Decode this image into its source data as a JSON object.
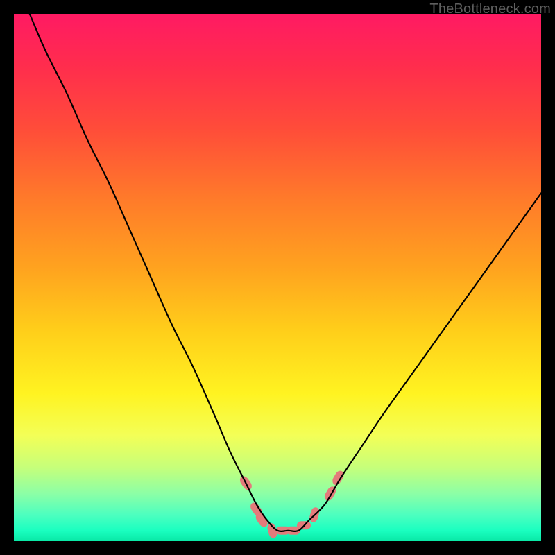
{
  "watermark": "TheBottleneck.com",
  "chart_data": {
    "type": "line",
    "title": "",
    "xlabel": "",
    "ylabel": "",
    "xlim": [
      0,
      100
    ],
    "ylim": [
      0,
      100
    ],
    "grid": false,
    "legend": false,
    "background_gradient": [
      "#ff1a63",
      "#ff2d4d",
      "#ff4d39",
      "#ff7a2a",
      "#ffa21f",
      "#ffce1a",
      "#fff321",
      "#f3ff57",
      "#c6ff7a",
      "#8cffa6",
      "#4dffbf",
      "#1affc0",
      "#09e8a6"
    ],
    "series": [
      {
        "name": "bottleneck-curve",
        "color": "#000000",
        "x": [
          3,
          6,
          10,
          14,
          18,
          22,
          26,
          30,
          34,
          38,
          41,
          44,
          46,
          48,
          50,
          52,
          54,
          56,
          59,
          62,
          66,
          70,
          75,
          80,
          85,
          90,
          95,
          100
        ],
        "y": [
          100,
          93,
          85,
          76,
          68,
          59,
          50,
          41,
          33,
          24,
          17,
          11,
          7,
          4,
          2,
          2,
          2,
          4,
          7,
          12,
          18,
          24,
          31,
          38,
          45,
          52,
          59,
          66
        ]
      }
    ],
    "markers": {
      "name": "highlight-markers",
      "color": "#e37b7b",
      "shape": "rounded-rect",
      "points": [
        {
          "x": 44,
          "y": 11
        },
        {
          "x": 46,
          "y": 6
        },
        {
          "x": 47,
          "y": 4
        },
        {
          "x": 49,
          "y": 2
        },
        {
          "x": 51,
          "y": 2
        },
        {
          "x": 53,
          "y": 2
        },
        {
          "x": 55,
          "y": 3
        },
        {
          "x": 57,
          "y": 5
        },
        {
          "x": 60,
          "y": 9
        },
        {
          "x": 61.5,
          "y": 12
        }
      ]
    }
  }
}
